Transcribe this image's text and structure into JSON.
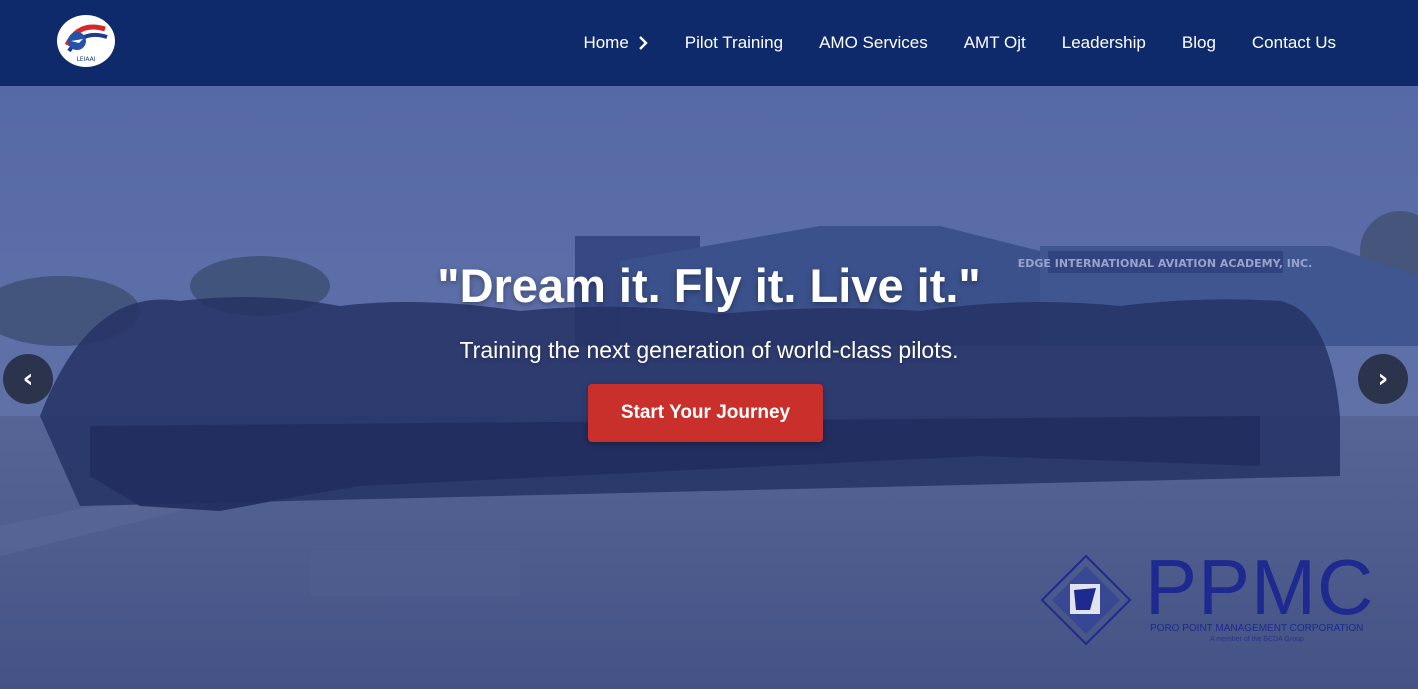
{
  "nav": {
    "logo_text": "LEIAAI",
    "items": [
      {
        "label": "Home"
      },
      {
        "label": "Pilot Training"
      },
      {
        "label": "AMO Services"
      },
      {
        "label": "AMT Ojt"
      },
      {
        "label": "Leadership"
      },
      {
        "label": "Blog"
      },
      {
        "label": "Contact Us"
      }
    ]
  },
  "hero": {
    "headline": "\"Dream it. Fly it. Live it.\"",
    "subheadline": "Training the next generation of world-class pilots.",
    "cta_label": "Start Your Journey",
    "prev_arrow": "‹",
    "next_arrow": "›",
    "building_sign": "EDGE INTERNATIONAL AVIATION ACADEMY, INC.",
    "watermark": {
      "title": "PPMC",
      "subtitle": "PORO POINT MANAGEMENT CORPORATION",
      "tagline": "A member of the BCDA Group"
    }
  },
  "colors": {
    "navbar": "#0f2a6b",
    "cta": "#c9302c",
    "ppmc": "#1e2a8f"
  }
}
